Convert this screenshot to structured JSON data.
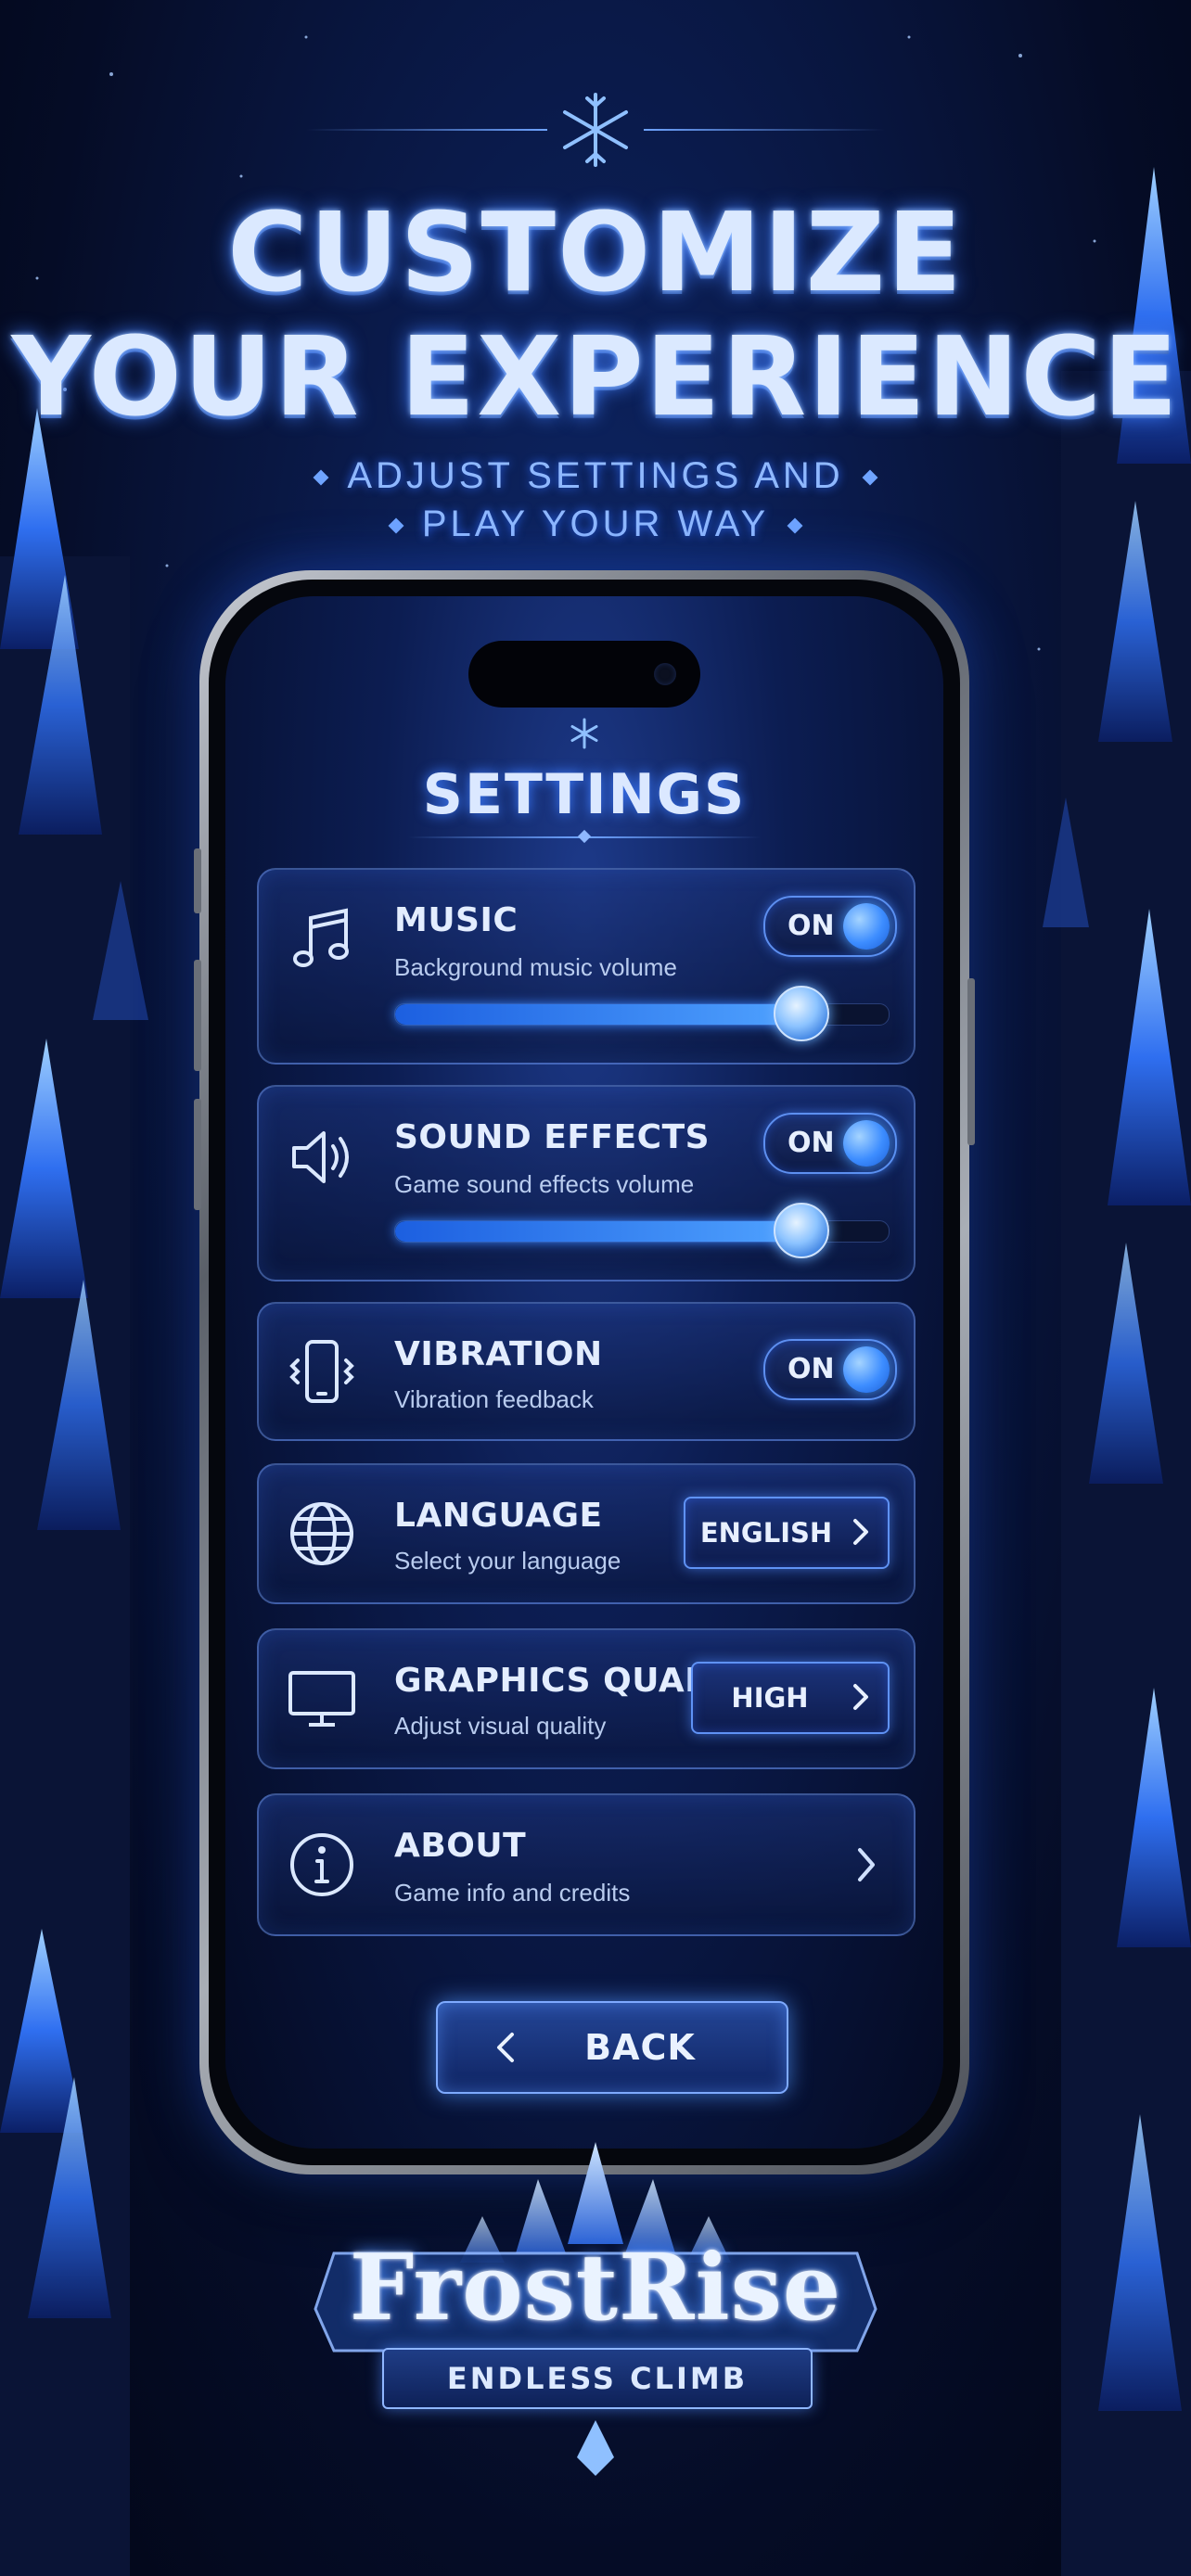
{
  "promo": {
    "headline_line1": "CUSTOMIZE",
    "headline_line2": "YOUR EXPERIENCE",
    "subtitle_line1": "ADJUST SETTINGS AND",
    "subtitle_line2": "PLAY YOUR WAY"
  },
  "settings": {
    "title": "SETTINGS",
    "music": {
      "label": "MUSIC",
      "description": "Background music volume",
      "toggle": "ON",
      "volume_fraction": 0.82
    },
    "sound_effects": {
      "label": "SOUND EFFECTS",
      "description": "Game sound effects volume",
      "toggle": "ON",
      "volume_fraction": 0.82
    },
    "vibration": {
      "label": "VIBRATION",
      "description": "Vibration feedback",
      "toggle": "ON"
    },
    "language": {
      "label": "LANGUAGE",
      "description": "Select your language",
      "value": "ENGLISH"
    },
    "graphics": {
      "label": "GRAPHICS QUALITY",
      "description": "Adjust visual quality",
      "value": "HIGH"
    },
    "about": {
      "label": "ABOUT",
      "description": "Game info and credits"
    },
    "back_label": "BACK"
  },
  "logo": {
    "title": "FrostRise",
    "tagline": "ENDLESS CLIMB"
  },
  "icons": [
    "snowflake-icon",
    "music-note-icon",
    "speaker-icon",
    "phone-vibrate-icon",
    "globe-icon",
    "monitor-icon",
    "info-icon",
    "chevron-right-icon",
    "chevron-left-icon"
  ],
  "colors": {
    "accent": "#4fa2ff",
    "background": "#050c26",
    "text": "#e3edff"
  }
}
